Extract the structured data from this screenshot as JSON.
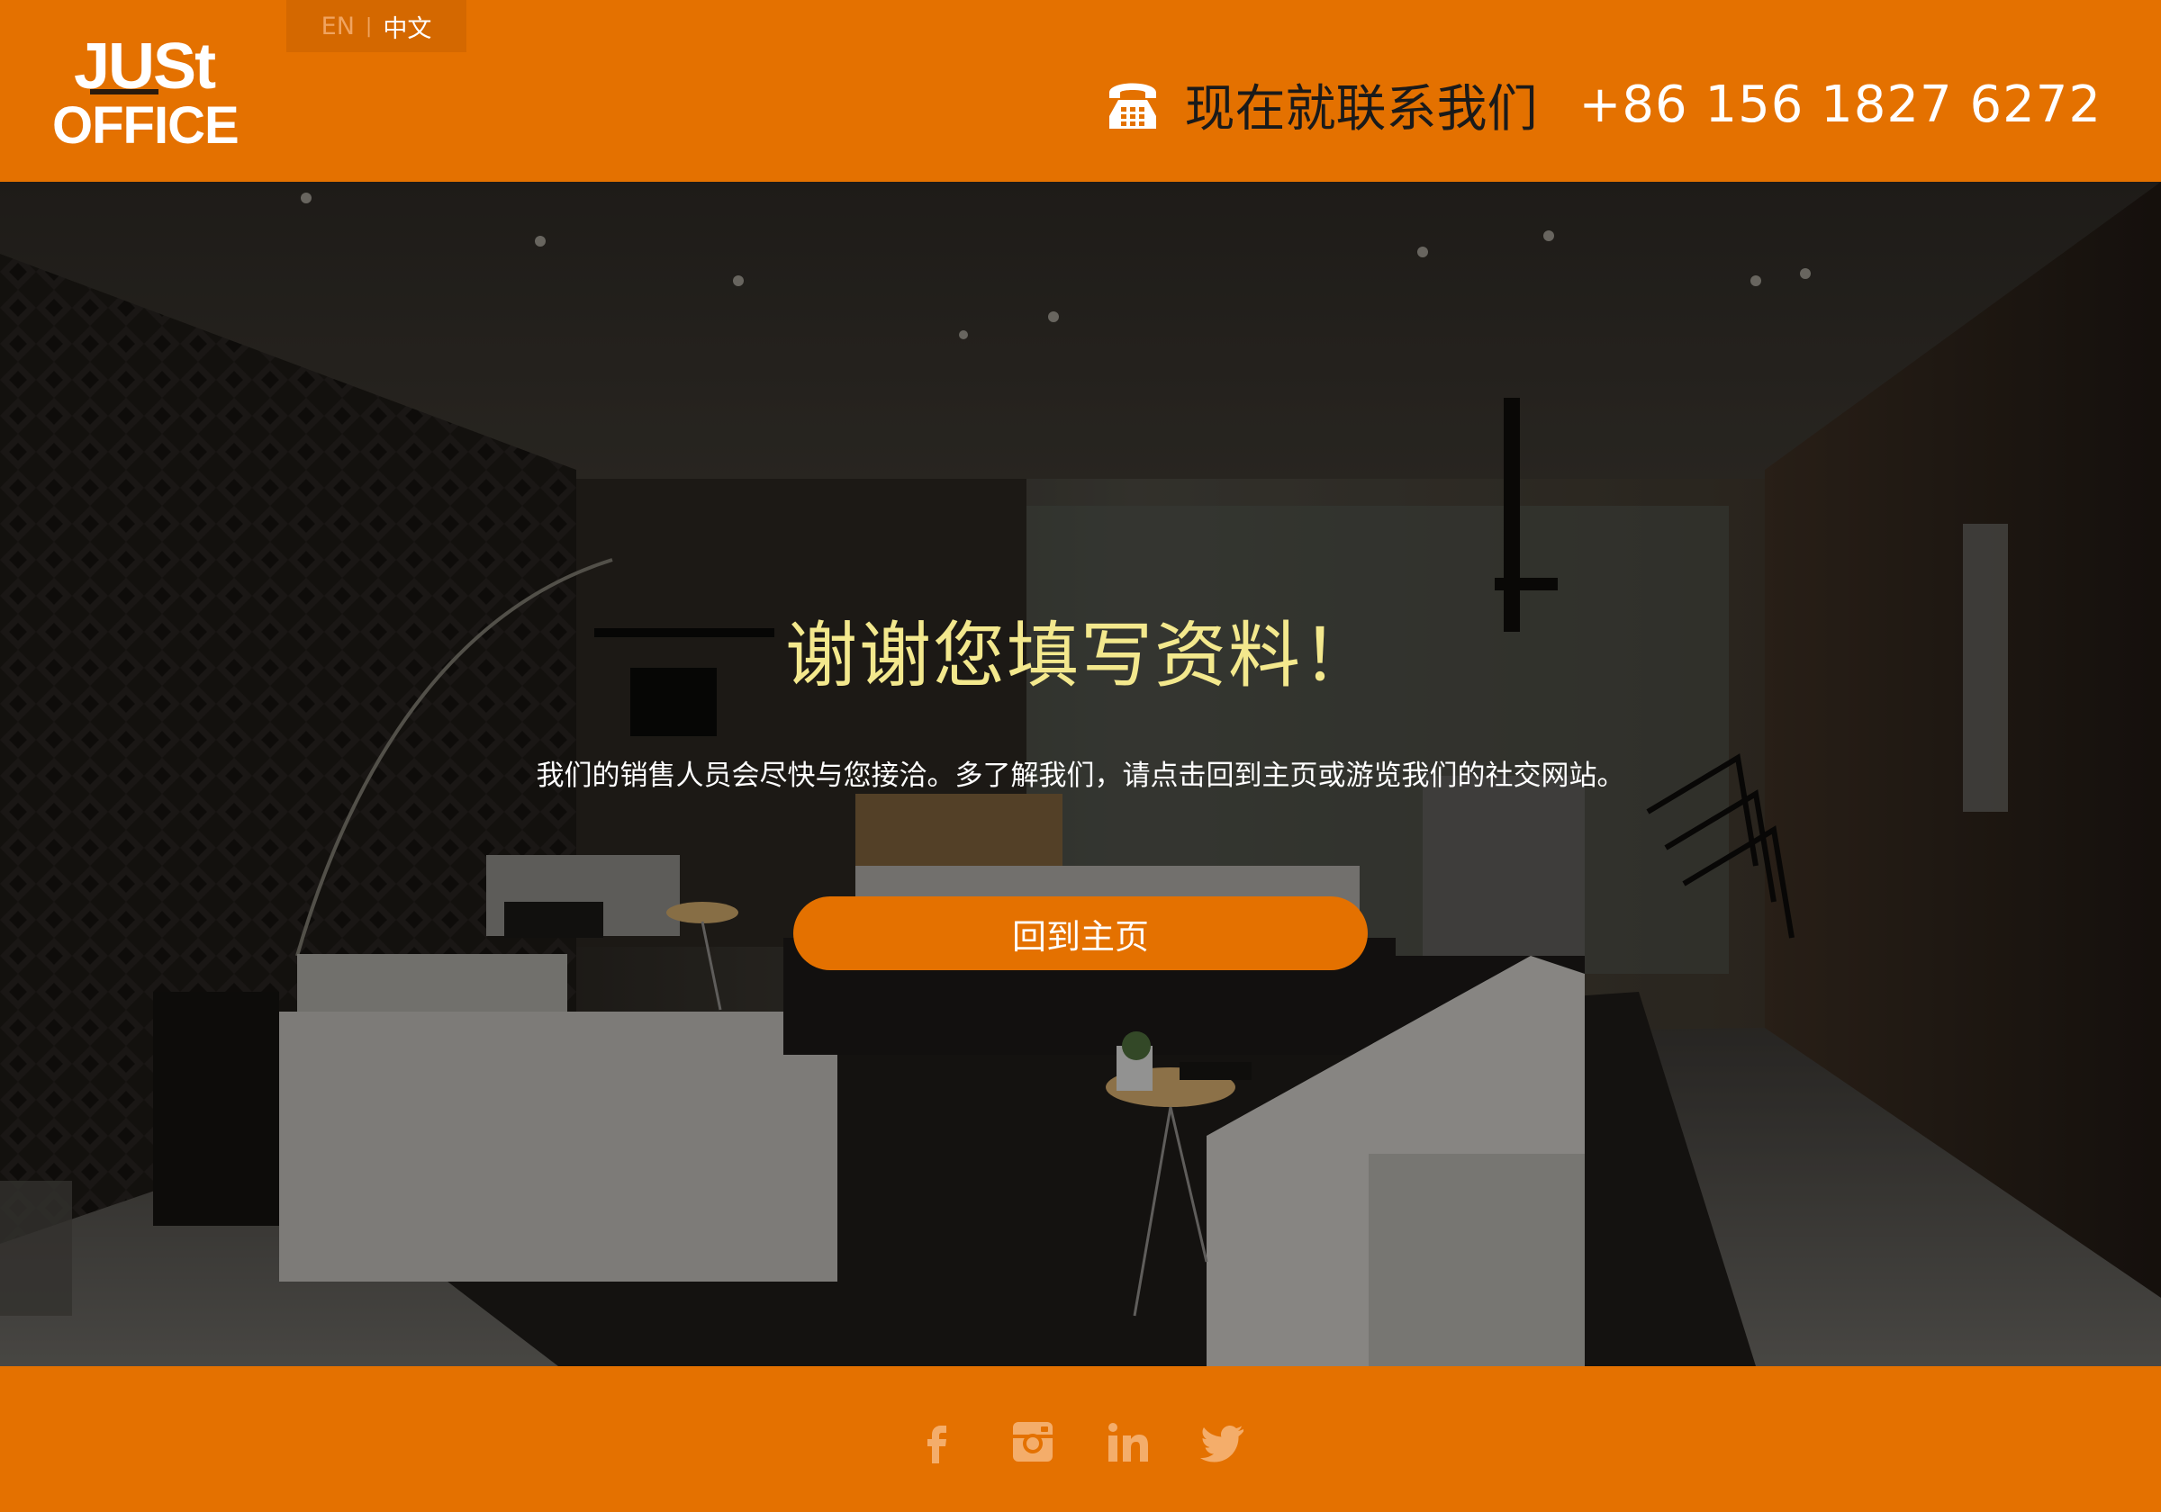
{
  "header": {
    "logo": {
      "line1": "JUSt",
      "line2": "OFFICE"
    },
    "lang": {
      "en": "EN",
      "sep": "|",
      "zh": "中文"
    },
    "contact": {
      "label": "现在就联系我们",
      "phone": "+86 156 1827 6272",
      "icon": "phone-icon"
    }
  },
  "hero": {
    "title": "谢谢您填写资料！",
    "message": "我们的销售人员会尽快与您接洽。多了解我们，请点击回到主页或游览我们的社交网站。",
    "button_label": "回到主页"
  },
  "footer": {
    "social": [
      {
        "icon": "facebook-icon"
      },
      {
        "icon": "instagram-icon"
      },
      {
        "icon": "linkedin-icon"
      },
      {
        "icon": "twitter-icon"
      }
    ]
  },
  "colors": {
    "brand": "#e47100",
    "title": "#f3e88d",
    "social_icon": "#f4ad6a"
  }
}
